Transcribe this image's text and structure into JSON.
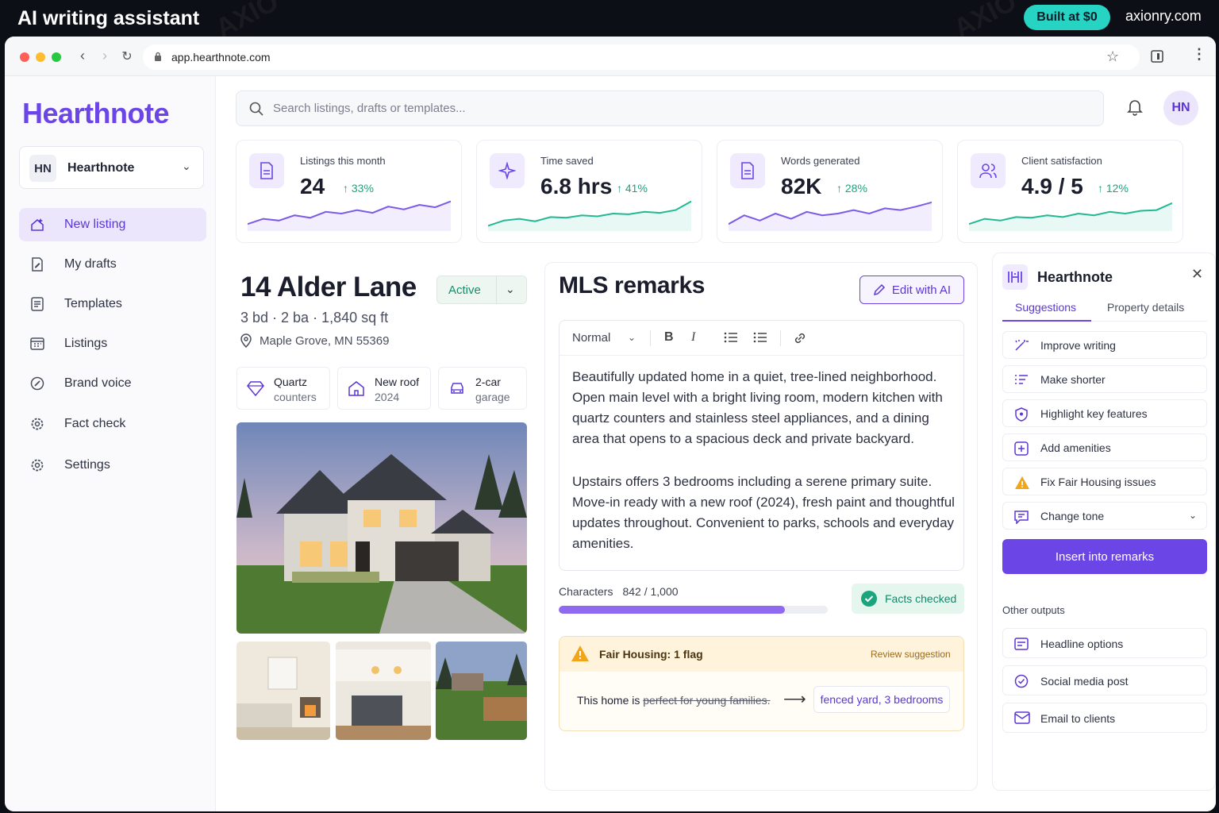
{
  "banner": {
    "title": "AI writing assistant",
    "badge": "Built at $0",
    "site": "axionry.com"
  },
  "browser": {
    "url": "app.hearthnote.com"
  },
  "sidebar": {
    "brand": "Hearthnote",
    "workspace": {
      "initials": "HN",
      "name": "Hearthnote"
    },
    "items": [
      {
        "label": "New listing",
        "icon": "house-sparkle-icon",
        "active": true
      },
      {
        "label": "My drafts",
        "icon": "document-edit-icon"
      },
      {
        "label": "Templates",
        "icon": "template-icon"
      },
      {
        "label": "Listings",
        "icon": "calendar-grid-icon"
      },
      {
        "label": "Brand voice",
        "icon": "brush-icon"
      },
      {
        "label": "Fact check",
        "icon": "gear-check-icon"
      },
      {
        "label": "Settings",
        "icon": "settings-icon"
      }
    ]
  },
  "header": {
    "search_placeholder": "Search listings, drafts or templates...",
    "avatar": "HN"
  },
  "stats": [
    {
      "label": "Listings this month",
      "value": "24",
      "delta": "33%",
      "icon": "document-icon",
      "trend": [
        0.2,
        0.35,
        0.3,
        0.45,
        0.38,
        0.55,
        0.5,
        0.6,
        0.52,
        0.7,
        0.62,
        0.75,
        0.68,
        0.85
      ]
    },
    {
      "label": "Time saved",
      "value": "6.8 hrs",
      "delta": "41%",
      "icon": "sparkle-icon",
      "trend": [
        0.15,
        0.3,
        0.35,
        0.28,
        0.4,
        0.38,
        0.45,
        0.42,
        0.5,
        0.48,
        0.55,
        0.52,
        0.6,
        0.85
      ]
    },
    {
      "label": "Words generated",
      "value": "82K",
      "delta": "28%",
      "icon": "document-icon",
      "trend": [
        0.2,
        0.45,
        0.3,
        0.5,
        0.35,
        0.55,
        0.45,
        0.5,
        0.6,
        0.5,
        0.65,
        0.6,
        0.7,
        0.82
      ]
    },
    {
      "label": "Client satisfaction",
      "value": "4.9 / 5",
      "delta": "12%",
      "icon": "users-icon",
      "trend": [
        0.2,
        0.35,
        0.3,
        0.4,
        0.38,
        0.45,
        0.4,
        0.5,
        0.45,
        0.55,
        0.5,
        0.58,
        0.6,
        0.8
      ]
    }
  ],
  "listing": {
    "address": "14 Alder Lane",
    "status": "Active",
    "specs": "3 bd · 2 ba · 1,840 sq ft",
    "location": "Maple Grove, MN 55369",
    "features": [
      {
        "line1": "Quartz",
        "line2": "counters",
        "icon": "diamond-icon"
      },
      {
        "line1": "New roof",
        "line2": "2024",
        "icon": "house-icon"
      },
      {
        "line1": "2-car",
        "line2": "garage",
        "icon": "car-icon"
      }
    ]
  },
  "editor": {
    "title": "MLS remarks",
    "edit_button": "Edit with AI",
    "style": "Normal",
    "paragraphs": [
      "Beautifully updated home in a quiet, tree-lined neighborhood. Open main level with a bright living room, modern kitchen with quartz counters and stainless steel appliances, and a dining area that opens to a spacious deck and private backyard.",
      "Upstairs offers 3 bedrooms including a serene primary suite. Move-in ready with a new roof (2024), fresh paint and thoughtful updates throughout. Convenient to parks, schools and everyday amenities."
    ],
    "chars_label": "Characters",
    "chars_value": "842 / 1,000",
    "chars_fraction": 0.842,
    "facts": "Facts checked"
  },
  "fair_housing": {
    "title": "Fair Housing: 1 flag",
    "review": "Review suggestion",
    "prefix": "This home is",
    "flagged": "perfect for young families.",
    "suggestion": "fenced yard, 3 bedrooms"
  },
  "ai_panel": {
    "name": "Hearthnote",
    "tabs": [
      "Suggestions",
      "Property details"
    ],
    "actions": [
      {
        "label": "Improve writing",
        "icon": "wand-icon"
      },
      {
        "label": "Make shorter",
        "icon": "list-shorten-icon"
      },
      {
        "label": "Highlight key features",
        "icon": "shield-star-icon"
      },
      {
        "label": "Add amenities",
        "icon": "plus-box-icon"
      },
      {
        "label": "Fix Fair Housing issues",
        "icon": "warning-icon"
      },
      {
        "label": "Change tone",
        "icon": "chat-icon"
      }
    ],
    "insert": "Insert into remarks",
    "other_title": "Other outputs",
    "outputs": [
      {
        "label": "Headline options",
        "icon": "headline-icon"
      },
      {
        "label": "Social media post",
        "icon": "check-badge-icon"
      },
      {
        "label": "Email to clients",
        "icon": "mail-icon"
      }
    ]
  },
  "colors": {
    "accent": "#6b45e6",
    "success": "#1aa57e",
    "teal": "#27d3c3",
    "warning": "#f2a41a"
  }
}
